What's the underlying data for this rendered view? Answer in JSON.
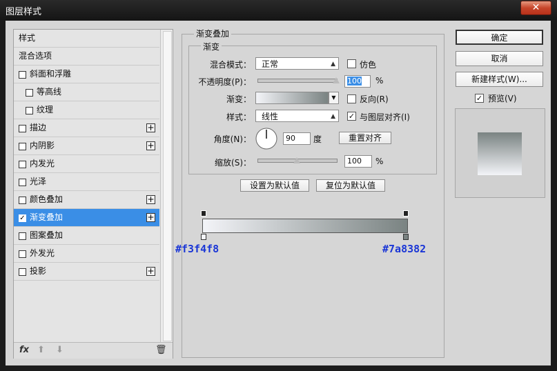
{
  "window": {
    "title": "图层样式",
    "close_glyph": "✕"
  },
  "styles_list": [
    {
      "label": "样式"
    },
    {
      "label": "混合选项"
    },
    {
      "label": "斜面和浮雕",
      "checkbox": true
    },
    {
      "label": "等高线",
      "checkbox": true,
      "indent": true
    },
    {
      "label": "纹理",
      "checkbox": true,
      "indent": true
    },
    {
      "label": "描边",
      "checkbox": true,
      "plus": true
    },
    {
      "label": "内阴影",
      "checkbox": true,
      "plus": true
    },
    {
      "label": "内发光",
      "checkbox": true
    },
    {
      "label": "光泽",
      "checkbox": true
    },
    {
      "label": "颜色叠加",
      "checkbox": true,
      "plus": true
    },
    {
      "label": "渐变叠加",
      "checkbox": true,
      "checked": true,
      "plus": true,
      "selected": true
    },
    {
      "label": "图案叠加",
      "checkbox": true
    },
    {
      "label": "外发光",
      "checkbox": true
    },
    {
      "label": "投影",
      "checkbox": true,
      "plus": true
    }
  ],
  "bottom_bar": {
    "fx_label": "fx",
    "fx_icon": "fx-icon",
    "up_icon": "arrow-up-icon",
    "down_icon": "arrow-down-icon",
    "trash_icon": "trash-icon"
  },
  "gradient_overlay": {
    "section_title": "渐变叠加",
    "group_title": "渐变",
    "blend_mode_label": "混合模式：",
    "blend_mode_value": "正常",
    "dither_label": "仿色",
    "dither_checked": false,
    "opacity_label": "不透明度(P)：",
    "opacity_value": "100",
    "opacity_unit": "%",
    "gradient_label": "渐变：",
    "reverse_label": "反向(R)",
    "reverse_checked": false,
    "style_label": "样式：",
    "style_value": "线性",
    "align_label": "与图层对齐(I)",
    "align_checked": true,
    "angle_label": "角度(N)：",
    "angle_value": "90",
    "angle_unit": "度",
    "reset_align_button": "重置对齐",
    "scale_label": "缩放(S)：",
    "scale_value": "100",
    "scale_unit": "%",
    "make_default_button": "设置为默认值",
    "reset_default_button": "复位为默认值",
    "stop_left_color": "#f3f4f8",
    "stop_right_color": "#7a8382",
    "opacity_slider_level": 1.0,
    "scale_slider_level": 0.5
  },
  "right_panel": {
    "ok_button": "确定",
    "cancel_button": "取消",
    "new_style_button": "新建样式(W)...",
    "preview_label": "预览(V)",
    "preview_checked": true
  },
  "colors": {
    "accent": "#3a8ee6",
    "hex_label": "#1a36d6"
  }
}
